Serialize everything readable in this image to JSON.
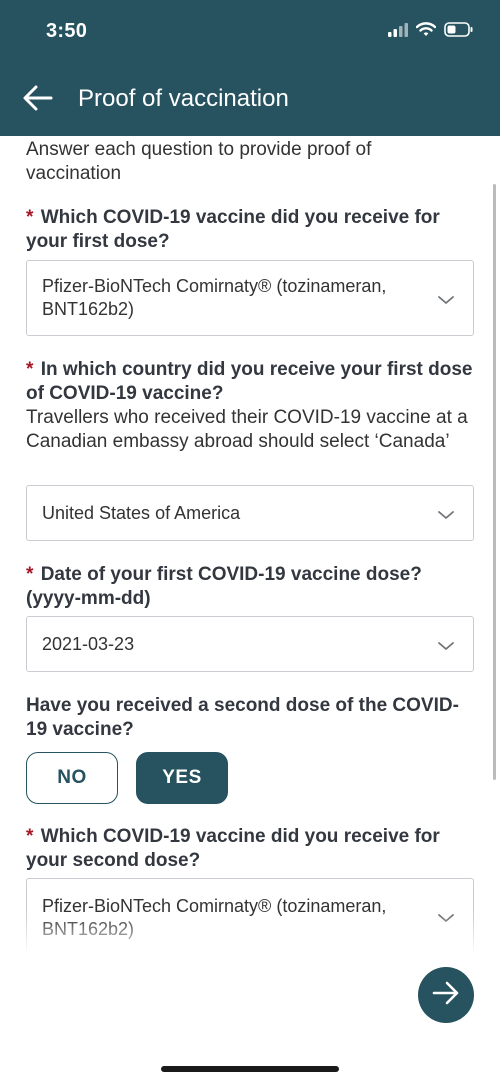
{
  "status_bar": {
    "time": "3:50",
    "icons": [
      "cellular-signal-icon",
      "wifi-icon",
      "battery-icon"
    ]
  },
  "header": {
    "title": "Proof of vaccination",
    "back_icon": "arrow-left-icon"
  },
  "intro": "Answer each question to provide proof of vaccination",
  "questions": {
    "first_vaccine": {
      "required_mark": "*",
      "label": "Which COVID-19 vaccine did you receive for your first dose?",
      "value": "Pfizer-BioNTech Comirnaty® (tozinameran, BNT162b2)"
    },
    "first_country": {
      "required_mark": "*",
      "label": "In which country did you receive your first dose of COVID-19 vaccine?",
      "hint": "Travellers who received their COVID-19 vaccine at a Canadian embassy abroad should select ‘Canada’",
      "value": "United States of America"
    },
    "first_date": {
      "required_mark": "*",
      "label": "Date of your first COVID-19 vaccine dose? (yyyy-mm-dd)",
      "value": "2021-03-23"
    },
    "second_dose": {
      "label": "Have you received a second dose of the COVID-19 vaccine?",
      "no_label": "NO",
      "yes_label": "YES",
      "selected": "YES"
    },
    "second_vaccine": {
      "required_mark": "*",
      "label": "Which COVID-19 vaccine did you receive for your second dose?",
      "value": "Pfizer-BioNTech Comirnaty® (tozinameran, BNT162b2)"
    }
  },
  "next_button_icon": "arrow-right-icon",
  "colors": {
    "primary": "#26535f",
    "required": "#a5182a",
    "border": "#c9ccd0"
  }
}
